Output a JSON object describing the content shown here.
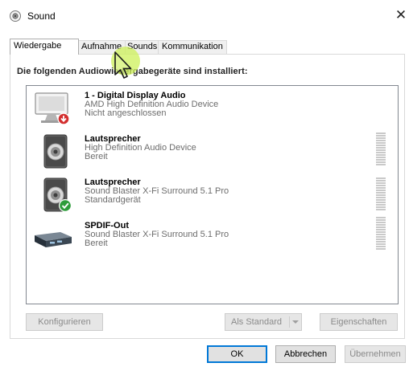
{
  "window": {
    "title": "Sound",
    "close_glyph": "✕"
  },
  "tabs": [
    {
      "label": "Wiedergabe",
      "active": true
    },
    {
      "label": "Aufnahme",
      "active": false
    },
    {
      "label": "Sounds",
      "active": false
    },
    {
      "label": "Kommunikation",
      "active": false
    }
  ],
  "instruction": "Die folgenden Audiowiedergabegeräte sind installiert:",
  "devices": [
    {
      "name": "1 - Digital Display Audio",
      "description": "AMD High Definition Audio Device",
      "state": "Nicht angeschlossen",
      "icon": "monitor-icon",
      "badge": "disconnected-badge-icon",
      "badge_color": "#d32f2f"
    },
    {
      "name": "Lautsprecher",
      "description": "High Definition Audio Device",
      "state": "Bereit",
      "icon": "speaker-icon"
    },
    {
      "name": "Lautsprecher",
      "description": "Sound Blaster X-Fi Surround 5.1 Pro",
      "state": "Standardgerät",
      "icon": "speaker-icon",
      "badge": "default-check-icon",
      "badge_color": "#2e9c3a"
    },
    {
      "name": "SPDIF-Out",
      "description": "Sound Blaster X-Fi Surround 5.1 Pro",
      "state": "Bereit",
      "icon": "spdif-device-icon"
    }
  ],
  "buttons": {
    "configure": "Konfigurieren",
    "set_default": "Als Standard",
    "properties": "Eigenschaften",
    "ok": "OK",
    "cancel": "Abbrechen",
    "apply": "Übernehmen"
  },
  "colors": {
    "accent": "#0078d7",
    "cursor_highlight": "#cdf05a"
  }
}
